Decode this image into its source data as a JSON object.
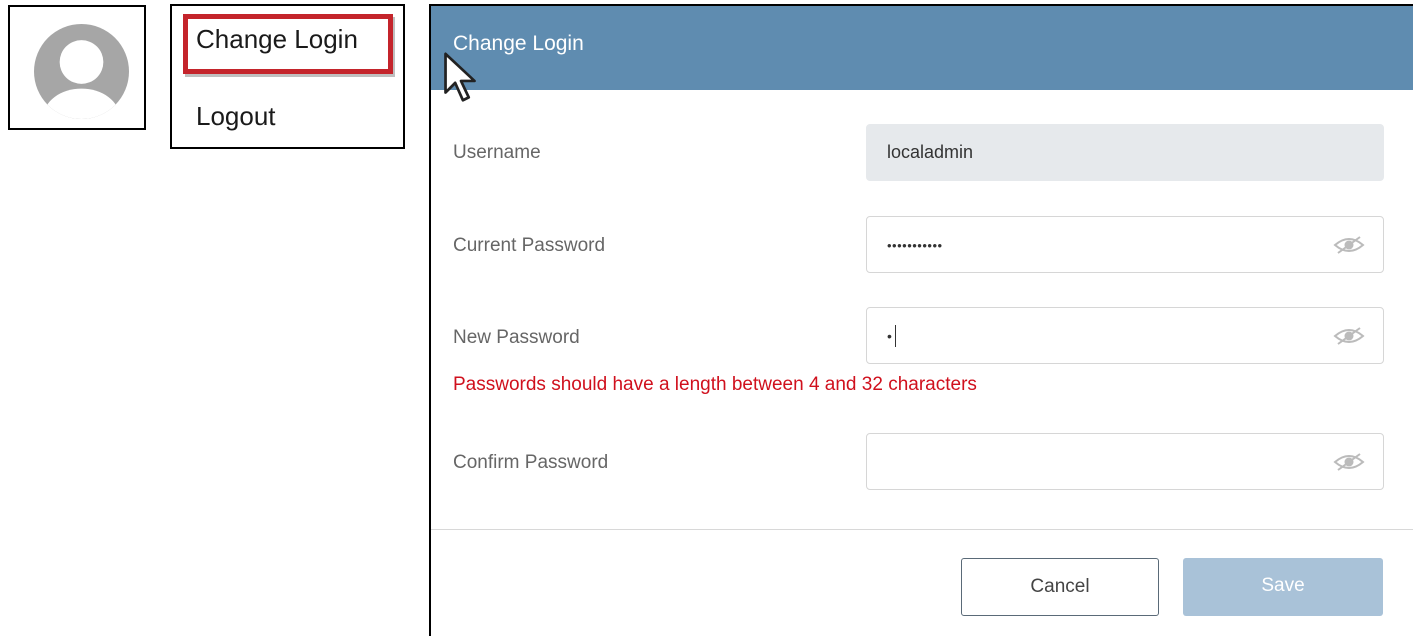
{
  "menu": {
    "change_login": "Change Login",
    "logout": "Logout"
  },
  "dialog": {
    "title": "Change Login",
    "fields": {
      "username": {
        "label": "Username",
        "value": "localadmin"
      },
      "current_password": {
        "label": "Current Password",
        "value": "•••••••••••"
      },
      "new_password": {
        "label": "New Password",
        "value": "•"
      },
      "confirm_password": {
        "label": "Confirm Password",
        "value": ""
      }
    },
    "error": "Passwords should have a length between 4 and 32 characters",
    "buttons": {
      "cancel": "Cancel",
      "save": "Save"
    }
  },
  "colors": {
    "header": "#5f8cb0",
    "error": "#d0101d",
    "highlight": "#c4242b",
    "save_disabled": "#a9c2d8"
  },
  "icons": [
    "avatar-icon",
    "mouse-cursor-icon",
    "eye-icon"
  ]
}
